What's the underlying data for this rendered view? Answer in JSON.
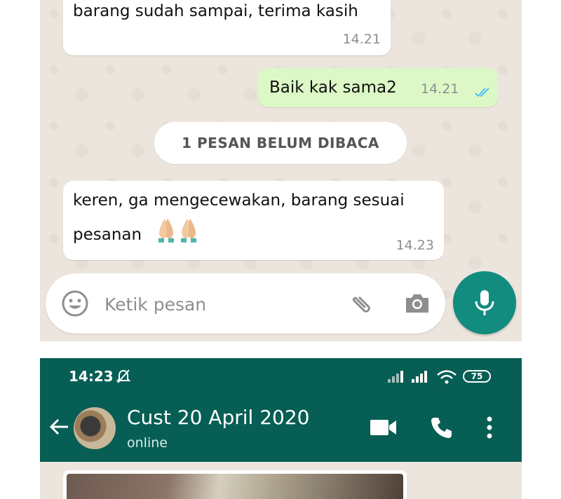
{
  "chat_top": {
    "messages": [
      {
        "direction": "incoming",
        "text": "barang sudah sampai, terima kasih",
        "time": "14.21"
      },
      {
        "direction": "outgoing",
        "text": "Baik kak sama2",
        "time": "14.21",
        "read": true
      },
      {
        "direction": "incoming",
        "text": "keren, ga mengecewakan, barang sesuai pesanan",
        "time": "14.23",
        "emoji": "folded-hands x2"
      }
    ],
    "unread_banner": "1 PESAN BELUM DIBACA",
    "composer": {
      "placeholder": "Ketik pesan",
      "icons": [
        "emoji-icon",
        "paperclip-icon",
        "camera-icon",
        "microphone-icon"
      ]
    }
  },
  "chat_bottom": {
    "status_bar": {
      "time": "14:23",
      "battery": "75",
      "icons": [
        "mute-bell-icon",
        "signal-icon",
        "signal-icon",
        "wifi-icon",
        "battery-icon"
      ]
    },
    "header": {
      "contact_name": "Cust 20 April 2020",
      "status": "online",
      "icons": [
        "back-arrow-icon",
        "video-call-icon",
        "phone-icon",
        "more-vert-icon"
      ]
    }
  },
  "colors": {
    "chat_background": "#ece5dd",
    "outgoing_bubble": "#dcf8c6",
    "header": "#075e54",
    "accent": "#128c7e",
    "read_ticks": "#4fc3f7"
  }
}
